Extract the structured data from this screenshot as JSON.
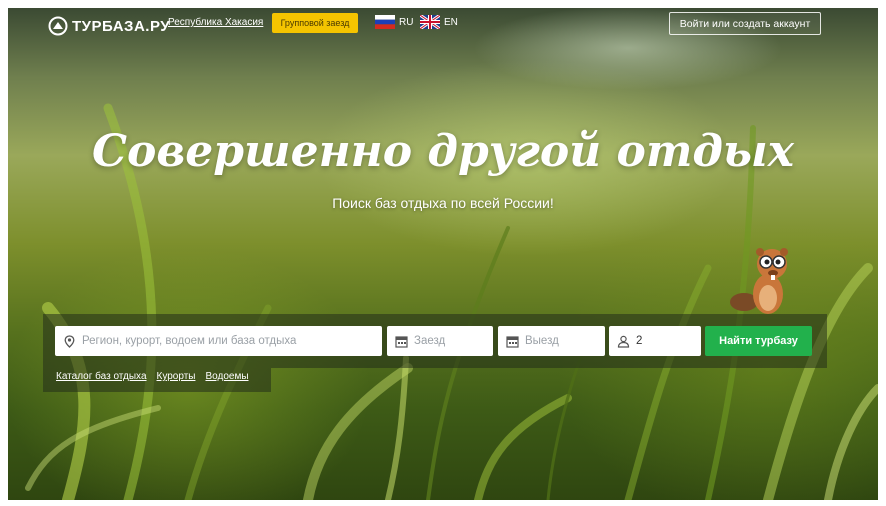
{
  "header": {
    "logo_text": "ТУРБАЗА.РУ",
    "region_link": "Республика Хакасия",
    "group_button": "Групповой заезд",
    "lang_ru": "RU",
    "lang_en": "EN",
    "login_button": "Войти или создать аккаунт"
  },
  "hero": {
    "title": "Совершенно другой отдых",
    "subtitle": "Поиск баз отдыха по всей России!"
  },
  "search": {
    "region_placeholder": "Регион, курорт, водоем или база отдыха",
    "checkin_placeholder": "Заезд",
    "checkout_placeholder": "Выезд",
    "guests_value": "2",
    "submit_label": "Найти турбазу"
  },
  "quick_links": [
    {
      "label": "Каталог баз отдыха"
    },
    {
      "label": "Курорты"
    },
    {
      "label": "Водоемы"
    }
  ],
  "colors": {
    "accent_yellow": "#f5c400",
    "accent_green": "#22b14c"
  },
  "icons": [
    "logo-icon",
    "russia-flag-icon",
    "uk-flag-icon",
    "location-pin-icon",
    "calendar-icon",
    "person-icon",
    "beaver-mascot"
  ]
}
